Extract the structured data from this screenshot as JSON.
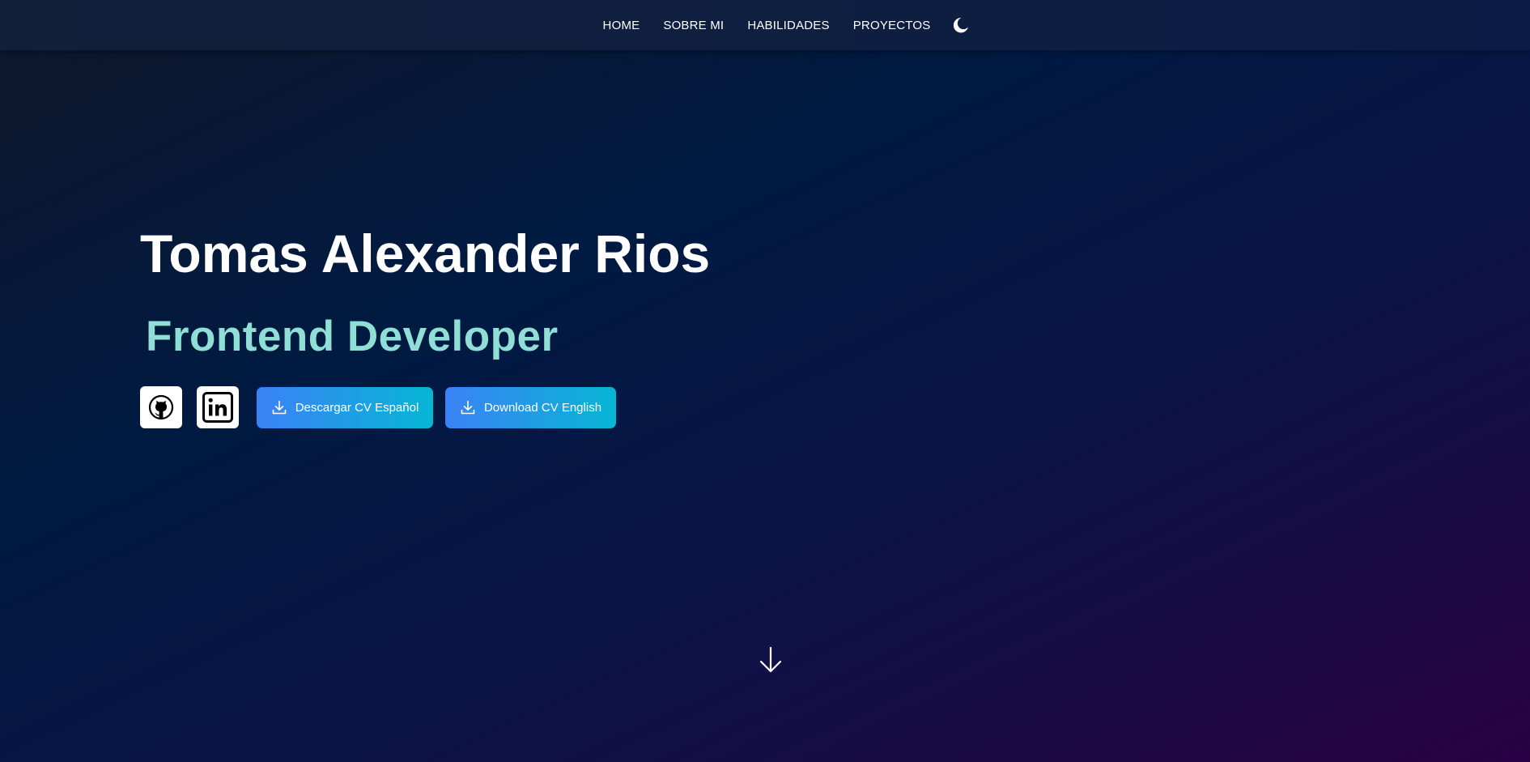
{
  "nav": {
    "items": [
      {
        "label": "HOME"
      },
      {
        "label": "SOBRE MI"
      },
      {
        "label": "HABILIDADES"
      },
      {
        "label": "PROYECTOS"
      }
    ],
    "theme_toggle_icon": "moon-icon"
  },
  "hero": {
    "name": "Tomas Alexander Rios",
    "role": "Frontend Developer",
    "role_color": "#8fdfd6"
  },
  "actions": {
    "github_icon": "github-icon",
    "linkedin_icon": "linkedin-icon",
    "cv_spanish_label": "Descargar CV Español",
    "cv_english_label": "Download CV English",
    "download_icon": "download-icon",
    "button_gradient": [
      "#3b82f6",
      "#06b6d4"
    ]
  },
  "scroll_icon": "arrow-down-icon",
  "colors": {
    "background_start": "#0f172a",
    "background_end": "#2a0045",
    "text": "#ffffff"
  }
}
